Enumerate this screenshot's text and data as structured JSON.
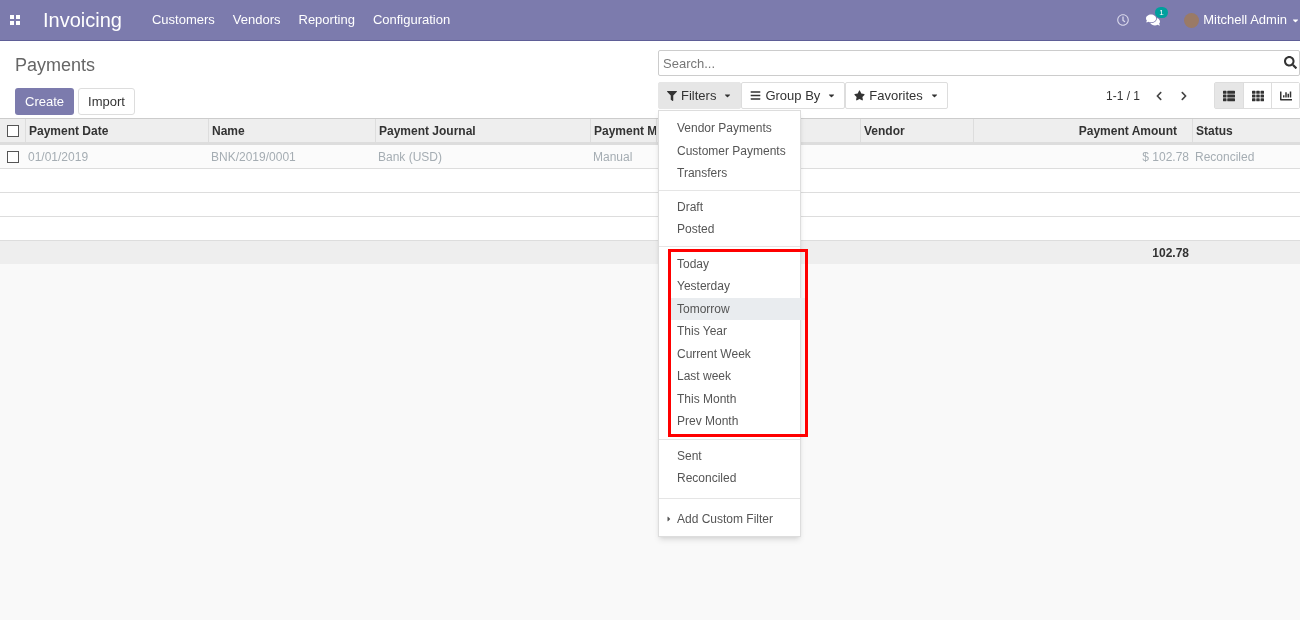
{
  "navbar": {
    "app_title": "Invoicing",
    "menu": [
      "Customers",
      "Vendors",
      "Reporting",
      "Configuration"
    ],
    "messages_badge": "1",
    "user": "Mitchell Admin"
  },
  "page_title": "Payments",
  "buttons": [
    {
      "label": "Create",
      "kind": "primary"
    },
    {
      "label": "Import",
      "kind": "secondary"
    }
  ],
  "search": {
    "placeholder": "Search..."
  },
  "search_buttons": [
    {
      "label": "Filters",
      "selected": true
    },
    {
      "label": "Group By",
      "selected": false
    },
    {
      "label": "Favorites",
      "selected": false
    }
  ],
  "pager": "1-1 / 1",
  "views": [
    {
      "selected": true
    },
    {
      "selected": false
    },
    {
      "selected": false
    }
  ],
  "table": {
    "select_all_checked": false,
    "columns": [
      {
        "label": "Payment Date"
      },
      {
        "label": "Name"
      },
      {
        "label": "Payment Journal"
      },
      {
        "label": "Payment M"
      },
      {},
      {
        "label": "Vendor"
      },
      {
        "label": "Payment Amount"
      },
      {
        "label": "Status"
      }
    ],
    "rows": [
      {
        "checked": false,
        "cells": [
          "01/01/2019",
          "BNK/2019/0001",
          "Bank (USD)",
          "Manual",
          "",
          "",
          "$ 102.78",
          "Reconciled"
        ]
      }
    ],
    "total": "102.78"
  },
  "filters_menu": {
    "groups": [
      {
        "highlighted": false,
        "items": [
          {
            "label": "Vendor Payments",
            "hovered": false
          },
          {
            "label": "Customer Payments",
            "hovered": false
          },
          {
            "label": "Transfers",
            "hovered": false
          }
        ]
      },
      {
        "highlighted": false,
        "items": [
          {
            "label": "Draft",
            "hovered": false
          },
          {
            "label": "Posted",
            "hovered": false
          }
        ]
      },
      {
        "highlighted": true,
        "items": [
          {
            "label": "Today",
            "hovered": false
          },
          {
            "label": "Yesterday",
            "hovered": false
          },
          {
            "label": "Tomorrow",
            "hovered": true
          },
          {
            "label": "This Year",
            "hovered": false
          },
          {
            "label": "Current Week",
            "hovered": false
          },
          {
            "label": "Last week",
            "hovered": false
          },
          {
            "label": "This Month",
            "hovered": false
          },
          {
            "label": "Prev Month",
            "hovered": false
          }
        ]
      },
      {
        "highlighted": false,
        "items": [
          {
            "label": "Sent",
            "hovered": false
          },
          {
            "label": "Reconciled",
            "hovered": false
          }
        ]
      }
    ],
    "custom_filter": "Add Custom Filter"
  }
}
